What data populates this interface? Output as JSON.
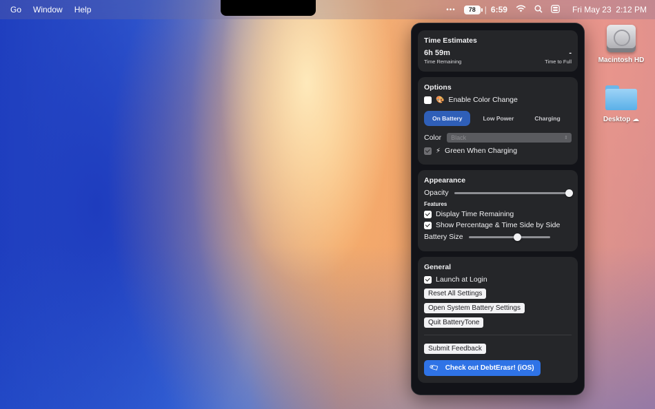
{
  "menubar": {
    "items": [
      "Go",
      "Window",
      "Help"
    ],
    "status": {
      "more": "•••",
      "battery_percent": "78",
      "separator": "|",
      "battery_time": "6:59",
      "datetime": "Fri May 23  2:12 PM"
    }
  },
  "desktop": {
    "icons": [
      {
        "label": "Macintosh HD"
      },
      {
        "label": "Desktop"
      }
    ]
  },
  "panel": {
    "time_estimates": {
      "title": "Time Estimates",
      "remaining_value": "6h 59m",
      "remaining_label": "Time Remaining",
      "full_value": "-",
      "full_label": "Time to Full"
    },
    "options": {
      "title": "Options",
      "enable_color_change": "Enable Color Change",
      "segments": [
        "On Battery",
        "Low Power",
        "Charging"
      ],
      "active_segment": "On Battery",
      "color_label": "Color",
      "color_value": "Black",
      "green_when_charging": "Green When Charging"
    },
    "appearance": {
      "title": "Appearance",
      "opacity_label": "Opacity",
      "opacity_value": 1.0,
      "features_label": "Features",
      "display_time_remaining": "Display Time Remaining",
      "show_side_by_side": "Show Percentage & Time Side by Side",
      "battery_size_label": "Battery Size",
      "battery_size_value": 0.6
    },
    "general": {
      "title": "General",
      "launch_at_login": "Launch at Login",
      "reset_all": "Reset All Settings",
      "open_system_battery": "Open System Battery Settings",
      "quit": "Quit BatteryTone",
      "submit_feedback": "Submit Feedback",
      "check_out": "Check out DebtErasr! (iOS)"
    }
  },
  "colors": {
    "panel_bg": "#121318",
    "card_bg": "#252629",
    "accent_segment": "#2f5fb8",
    "cta_blue": "#2f73e6"
  }
}
